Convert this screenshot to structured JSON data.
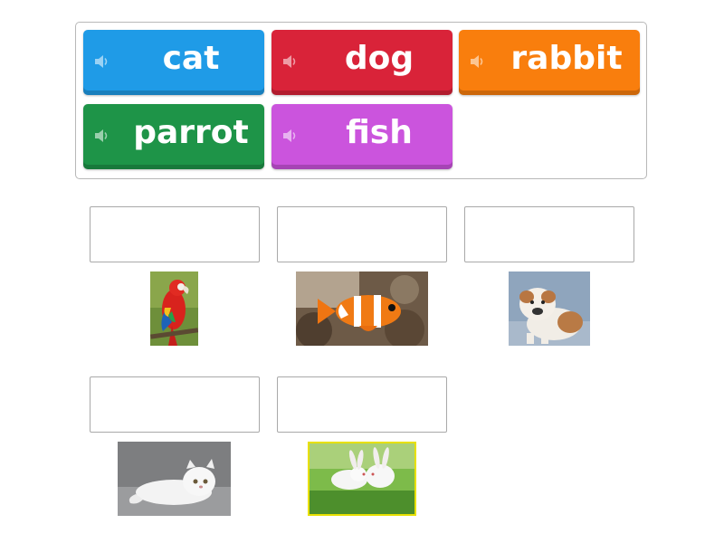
{
  "tiles": [
    {
      "label": "cat",
      "color": "#1f9be7",
      "icon": "speaker-icon"
    },
    {
      "label": "dog",
      "color": "#d92339",
      "icon": "speaker-icon"
    },
    {
      "label": "rabbit",
      "color": "#f97e0d",
      "icon": "speaker-icon"
    },
    {
      "label": "parrot",
      "color": "#1e9448",
      "icon": "speaker-icon"
    },
    {
      "label": "fish",
      "color": "#cb54dd",
      "icon": "speaker-icon"
    }
  ],
  "drop_targets": [
    {
      "value": "",
      "image": "parrot-photo"
    },
    {
      "value": "",
      "image": "clownfish-photo"
    },
    {
      "value": "",
      "image": "bulldog-puppy-photo"
    },
    {
      "value": "",
      "image": "white-persian-cat-photo"
    },
    {
      "value": "",
      "image": "white-rabbits-photo"
    }
  ]
}
